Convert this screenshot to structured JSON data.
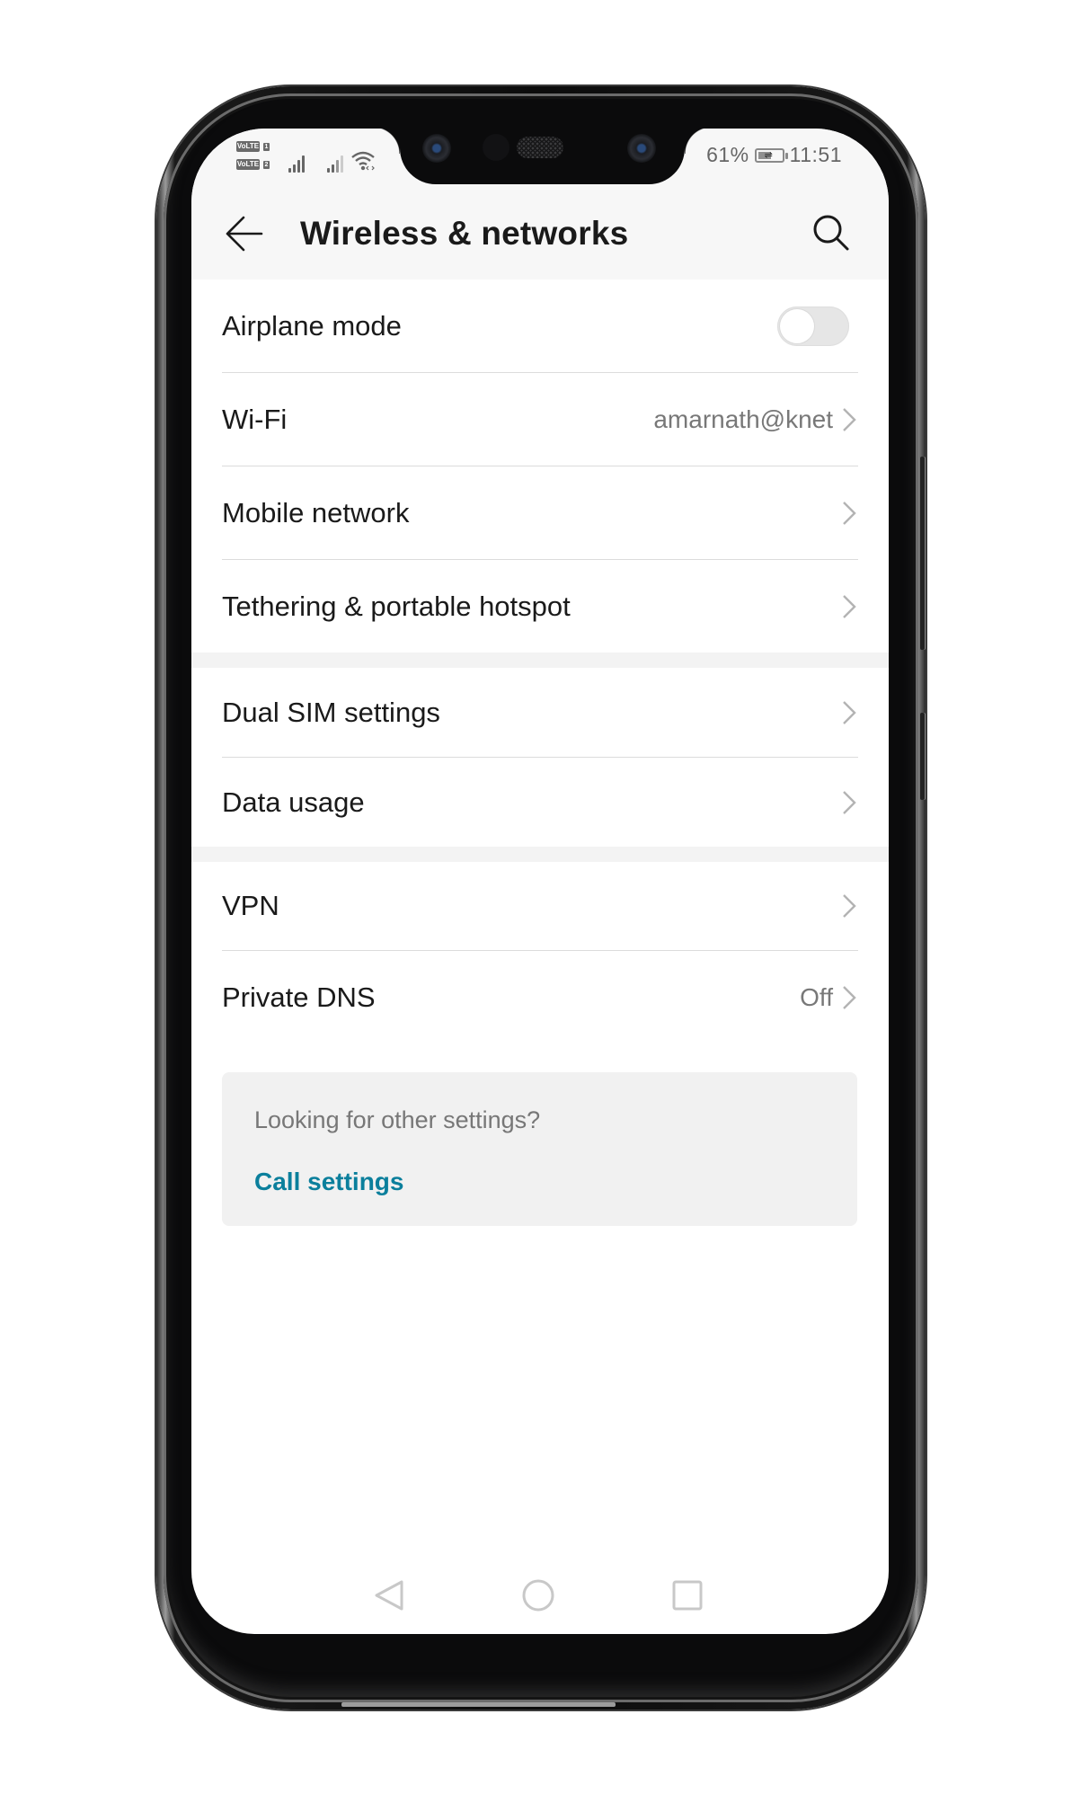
{
  "status_bar": {
    "sim1_badge": "VoLTE",
    "sim1_num": "1",
    "sim2_badge": "VoLTE",
    "sim2_num": "2",
    "battery_percent": "61%",
    "battery_level": 0.61,
    "time": "11:51",
    "icons": [
      "volte-icon",
      "signal-sim1-icon",
      "signal-sim2-icon",
      "wifi-icon",
      "battery-icon"
    ]
  },
  "appbar": {
    "back_icon": "arrow-left-icon",
    "title": "Wireless & networks",
    "search_icon": "search-icon"
  },
  "groups": [
    {
      "items": [
        {
          "label": "Airplane mode",
          "type": "toggle",
          "toggle_on": false
        },
        {
          "label": "Wi-Fi",
          "value": "amarnath@knet",
          "type": "link"
        },
        {
          "label": "Mobile network",
          "type": "link"
        },
        {
          "label": "Tethering & portable hotspot",
          "type": "link"
        }
      ]
    },
    {
      "items": [
        {
          "label": "Dual SIM settings",
          "type": "link"
        },
        {
          "label": "Data usage",
          "type": "link"
        }
      ]
    },
    {
      "items": [
        {
          "label": "VPN",
          "type": "link"
        },
        {
          "label": "Private DNS",
          "value": "Off",
          "type": "link"
        }
      ]
    }
  ],
  "suggestion_card": {
    "question": "Looking for other settings?",
    "link_label": "Call settings",
    "link_color": "#0b7f9c"
  },
  "navbar": {
    "back_icon": "nav-back-icon",
    "home_icon": "nav-home-icon",
    "recents_icon": "nav-recents-icon"
  },
  "colors": {
    "accent": "#0b7f9c",
    "primary_text": "#1a1a1a",
    "secondary_text": "#787878",
    "divider": "#dcdcdc",
    "header_bg": "#f7f7f7",
    "group_gap": "#f3f3f3",
    "toggle_off": "#e6e6e6"
  }
}
